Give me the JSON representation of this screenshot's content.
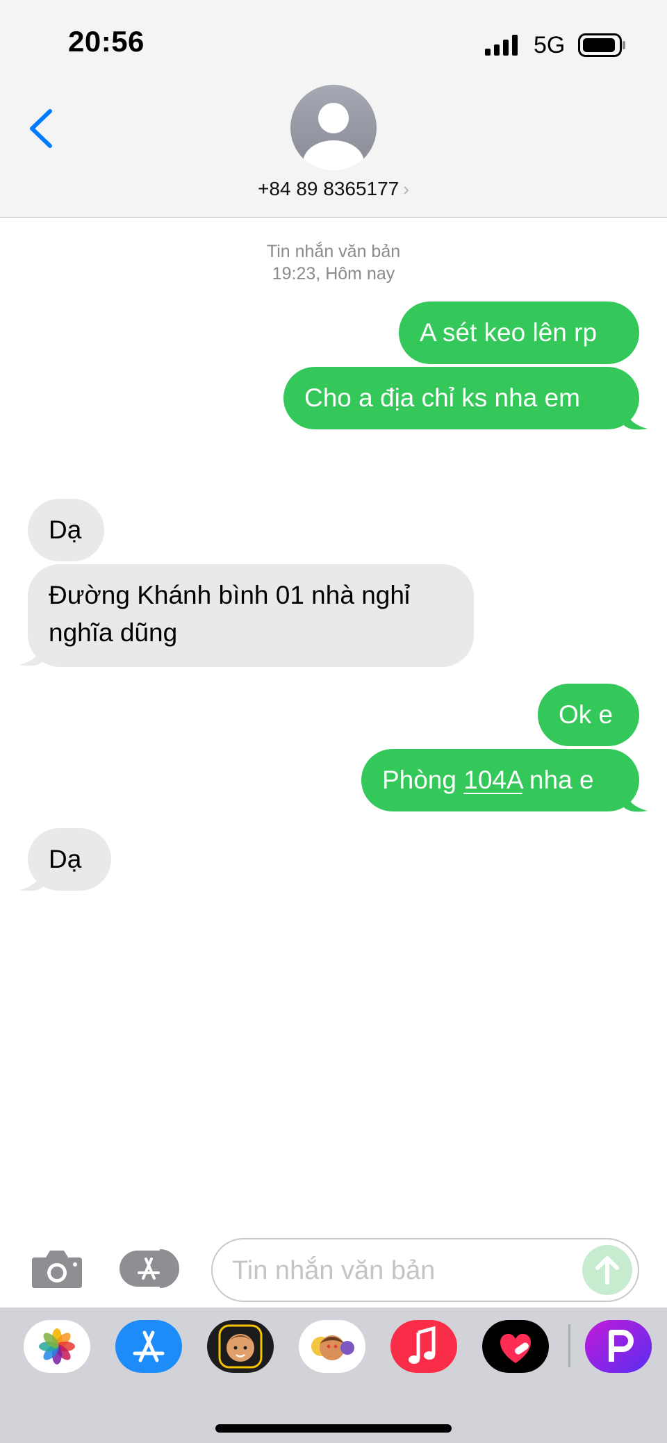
{
  "status_bar": {
    "time": "20:56",
    "network": "5G",
    "signal_icon": "cellular-signal-icon",
    "battery_icon": "battery-icon"
  },
  "header": {
    "back_icon": "chevron-left-icon",
    "avatar_icon": "person-avatar-icon",
    "contact": "+84 89 8365177",
    "contact_chevron": "›"
  },
  "thread": {
    "service_label": "Tin nhắn văn bản",
    "timestamp": "19:23, Hôm nay",
    "messages": [
      {
        "direction": "outgoing",
        "text": "A sét keo lên rp"
      },
      {
        "direction": "outgoing",
        "text": "Cho a địa chỉ ks nha em"
      },
      {
        "direction": "incoming",
        "text": "Dạ"
      },
      {
        "direction": "incoming",
        "lines": [
          "Đường Khánh bình 01 nhà nghỉ",
          "nghĩa dũng"
        ]
      },
      {
        "direction": "outgoing",
        "text": "Ok e"
      },
      {
        "direction": "outgoing",
        "prefix": "Phòng ",
        "link": "104A",
        "suffix": " nha e"
      },
      {
        "direction": "incoming",
        "text": "Dạ"
      }
    ]
  },
  "composer": {
    "camera_icon": "camera-icon",
    "apps_icon": "app-store-icon",
    "placeholder": "Tin nhắn văn bản",
    "value": "",
    "send_icon": "arrow-up-icon"
  },
  "app_drawer": {
    "apps": [
      "photos-icon",
      "app-store-icon",
      "memoji-icon",
      "animoji-stickers-icon",
      "music-icon",
      "digital-touch-icon",
      "picsart-icon"
    ]
  },
  "colors": {
    "outgoing_bubble": "#34c759",
    "incoming_bubble": "#e9e9eb",
    "accent": "#007aff"
  }
}
